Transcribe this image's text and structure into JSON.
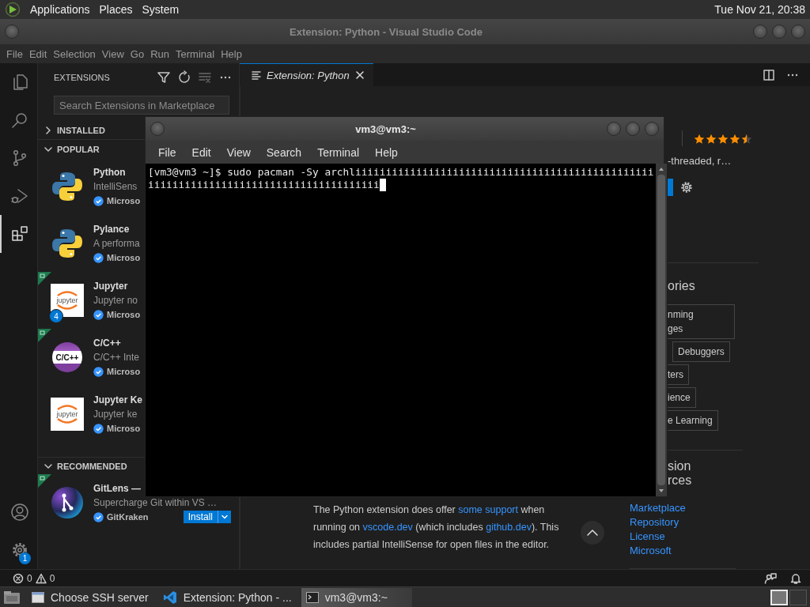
{
  "top_panel": {
    "menus": [
      "Applications",
      "Places",
      "System"
    ],
    "clock": "Tue Nov 21, 20:38"
  },
  "vscode": {
    "title": "Extension: Python - Visual Studio Code",
    "menu": [
      "File",
      "Edit",
      "Selection",
      "View",
      "Go",
      "Run",
      "Terminal",
      "Help"
    ],
    "activity_bar": [
      {
        "kind": "explorer",
        "selected": false
      },
      {
        "kind": "search",
        "selected": false
      },
      {
        "kind": "source_control",
        "selected": false
      },
      {
        "kind": "run_debug",
        "selected": false
      },
      {
        "kind": "extensions",
        "selected": true
      }
    ],
    "activity_bar_bottom": [
      {
        "kind": "account"
      },
      {
        "kind": "settings",
        "badge": "1"
      }
    ],
    "sidebar": {
      "title": "EXTENSIONS",
      "search": {
        "placeholder": "Search Extensions in Marketplace"
      },
      "sections": [
        {
          "title": "INSTALLED",
          "expanded": false
        },
        {
          "title": "POPULAR",
          "expanded": true,
          "items": [
            {
              "kind": "python",
              "name": "Python",
              "description": "IntelliSens",
              "publisher": "Microso",
              "verified": true,
              "ribbon": false
            },
            {
              "kind": "python",
              "name": "Pylance",
              "description": "A performa",
              "publisher": "Microso",
              "verified": true,
              "ribbon": false
            },
            {
              "kind": "jupyter",
              "logo_text": "jupyter",
              "name": "Jupyter",
              "description": "Jupyter no",
              "publisher": "Microso",
              "verified": true,
              "ribbon": true,
              "count": "4"
            },
            {
              "kind": "cpp",
              "logo_text": "C/C++",
              "name": "C/C++",
              "description": "C/C++ Inte",
              "publisher": "Microso",
              "verified": true,
              "ribbon": true
            },
            {
              "kind": "jupyter",
              "logo_text": "jupyter",
              "name": "Jupyter Ke",
              "description": "Jupyter ke",
              "publisher": "Microso",
              "verified": true,
              "ribbon": false
            }
          ]
        },
        {
          "title": "RECOMMENDED",
          "expanded": true,
          "items": [
            {
              "kind": "gitlens",
              "name": "GitLens —",
              "description": "Supercharge Git within VS …",
              "publisher": "GitKraken",
              "verified": true,
              "ribbon": true,
              "action": "Install"
            }
          ]
        }
      ]
    },
    "editor": {
      "tabs": [
        {
          "label": "Extension: Python",
          "selected": true
        }
      ],
      "details": {
        "stars": 4.5,
        "description": "-threaded, r…",
        "categories_heading": "ories",
        "categories": [
          "nming\nges",
          "Debuggers",
          "ters",
          "ience",
          "e Learning"
        ],
        "resources_heading": "sion\nrces",
        "resources": [
          "Marketplace",
          "Repository",
          "License",
          "Microsoft"
        ],
        "paragraph": [
          {
            "text": "The Python extension does offer "
          },
          {
            "text": "some support",
            "link": true
          },
          {
            "text": " when running on "
          },
          {
            "text": "vscode.dev",
            "link": true
          },
          {
            "text": " (which includes "
          },
          {
            "text": "github.dev",
            "link": true
          },
          {
            "text": "). This includes partial IntelliSense for open files in the editor."
          }
        ]
      }
    },
    "status_bar": {
      "errors": "0",
      "warnings": "0"
    }
  },
  "terminal": {
    "title": "vm3@vm3:~",
    "menu": [
      "File",
      "Edit",
      "View",
      "Search",
      "Terminal",
      "Help"
    ],
    "lines": [
      "[vm3@vm3 ~]$ sudo pacman -Sy archliiiiiiiiiiiiiiiiiiiiiiiiiiiiiiiiiiiiiiiiiiiiiiiii",
      "iiiiiiiiiiiiiiiiiiiiiiiiiiiiiiiiiiiiii"
    ]
  },
  "taskbar": {
    "items": [
      {
        "kind": "window",
        "label": "Choose SSH server",
        "selected": false
      },
      {
        "kind": "vscode",
        "label": "Extension: Python - ...",
        "selected": false
      },
      {
        "kind": "terminal",
        "label": "vm3@vm3:~",
        "selected": true
      }
    ],
    "workspaces": [
      {
        "selected": true
      },
      {
        "selected": false
      }
    ]
  }
}
